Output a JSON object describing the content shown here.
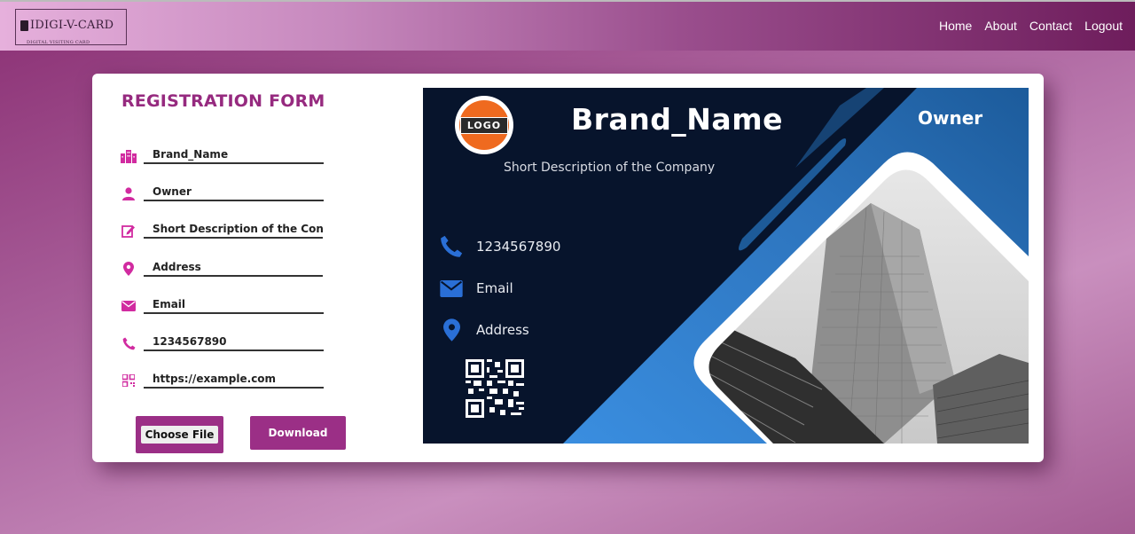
{
  "header": {
    "logo_text": "IDIGI-V-CARD",
    "logo_sub": "DIGITAL VISITING CARD",
    "nav": [
      "Home",
      "About",
      "Contact",
      "Logout"
    ]
  },
  "form": {
    "title": "REGISTRATION FORM",
    "fields": [
      {
        "icon": "building-icon",
        "value": "Brand_Name"
      },
      {
        "icon": "user-icon",
        "value": "Owner"
      },
      {
        "icon": "edit-icon",
        "value": "Short Description of the Con"
      },
      {
        "icon": "location-icon",
        "value": "Address"
      },
      {
        "icon": "envelope-icon",
        "value": "Email"
      },
      {
        "icon": "phone-icon",
        "value": "1234567890"
      },
      {
        "icon": "qrcode-icon",
        "value": "https://example.com"
      }
    ],
    "choose_file_label": "Choose File",
    "download_label": "Download"
  },
  "card": {
    "logo_text": "LOGO",
    "brand": "Brand_Name",
    "owner": "Owner",
    "description": "Short Description of the Company",
    "phone": "1234567890",
    "email": "Email",
    "address": "Address"
  },
  "colors": {
    "accent": "#962a7f",
    "icon_pink": "#d12ba0",
    "card_bg": "#07142c",
    "card_blue": "#2f7fd1"
  }
}
